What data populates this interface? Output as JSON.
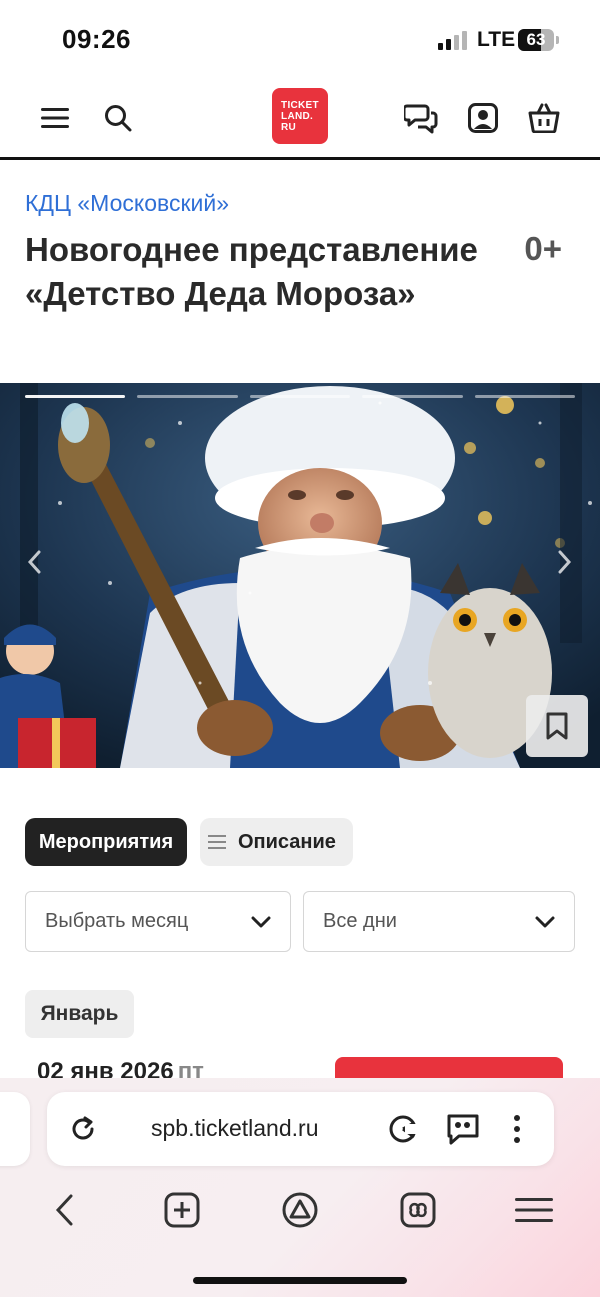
{
  "status_bar": {
    "time": "09:26",
    "network": "LTE",
    "battery": "63",
    "battery_level_pct": 63
  },
  "header": {
    "logo_text": "TICKET\nLAND.\nRU",
    "icons": [
      "menu-icon",
      "search-icon",
      "chat-icon",
      "profile-icon",
      "basket-icon"
    ]
  },
  "venue": "КДЦ «Московский»",
  "event": {
    "title": "Новогоднее представление «Детство Деда Мороза»",
    "age_rating": "0+"
  },
  "gallery": {
    "slides": 5,
    "active_slide": 1
  },
  "tabs": [
    {
      "label": "Мероприятия",
      "active": true
    },
    {
      "label": "Описание",
      "active": false
    }
  ],
  "filters": {
    "month_placeholder": "Выбрать месяц",
    "day_value": "Все дни"
  },
  "month_label": "Январь",
  "events": [
    {
      "date": "02 янв 2026",
      "weekday": "пт"
    }
  ],
  "browser": {
    "url": "spb.ticketland.ru"
  },
  "colors": {
    "brand": "#e8333d",
    "link": "#2f6fd6",
    "dark": "#222222"
  }
}
